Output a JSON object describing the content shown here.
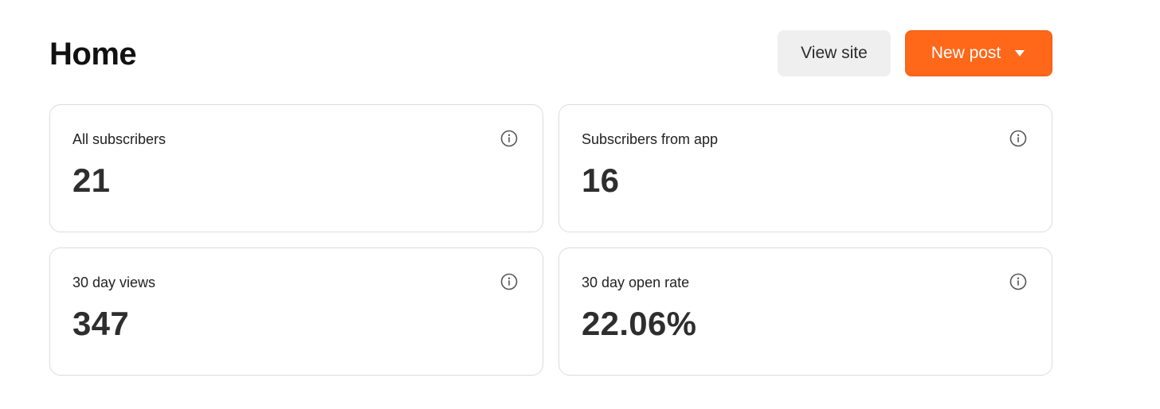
{
  "page": {
    "title": "Home"
  },
  "actions": {
    "view_site_label": "View site",
    "new_post_label": "New post"
  },
  "colors": {
    "accent": "#ff6719",
    "secondary_button_bg": "#efefef",
    "card_border": "#dcdcdc"
  },
  "stats": [
    {
      "label": "All subscribers",
      "value": "21",
      "icon": "info-icon"
    },
    {
      "label": "Subscribers from app",
      "value": "16",
      "icon": "info-icon"
    },
    {
      "label": "30 day views",
      "value": "347",
      "icon": "info-icon"
    },
    {
      "label": "30 day open rate",
      "value": "22.06%",
      "icon": "info-icon"
    }
  ]
}
